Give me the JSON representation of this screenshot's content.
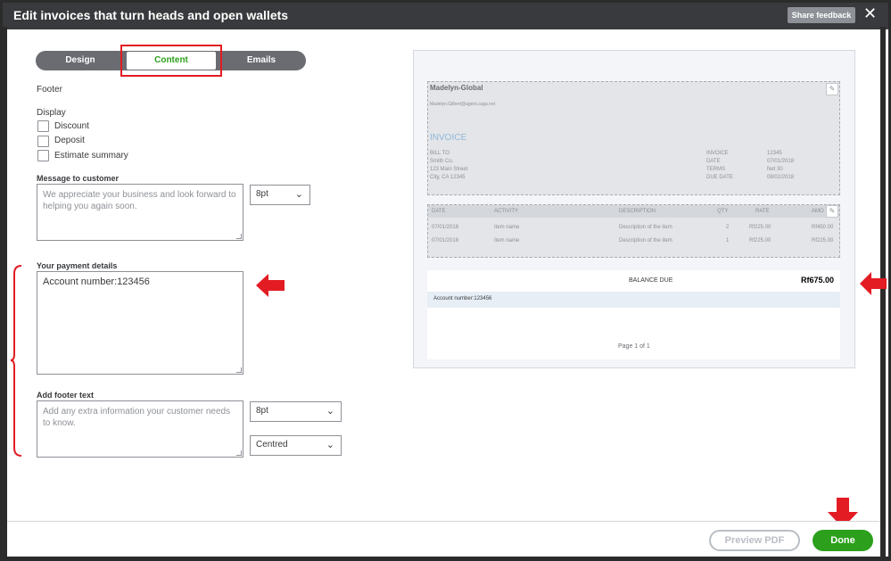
{
  "window": {
    "title": "Edit invoices that turn heads and open wallets",
    "share_feedback": "Share feedback",
    "close": "✕"
  },
  "tabs": [
    {
      "label": "Design"
    },
    {
      "label": "Content"
    },
    {
      "label": "Emails"
    }
  ],
  "form": {
    "section": "Footer",
    "display_label": "Display",
    "checkboxes": [
      {
        "label": "Discount",
        "checked": false
      },
      {
        "label": "Deposit",
        "checked": false
      },
      {
        "label": "Estimate summary",
        "checked": false
      }
    ],
    "message_label": "Message to customer",
    "message_placeholder": "We appreciate your business and look forward to helping you again soon.",
    "message_font_size": "8pt",
    "payment_label": "Your payment details",
    "payment_value": "Account number:123456",
    "footer_label": "Add footer text",
    "footer_placeholder": "Add any extra information your customer needs to know.",
    "footer_font_size": "8pt",
    "footer_align": "Centred"
  },
  "preview": {
    "company": "Madelyn-Global",
    "email": "Madelyn.Gilbert@agent.cuga.net",
    "invoice_title": "INVOICE",
    "bill_to_label": "BILL TO",
    "bill_to_lines": [
      "Smith Co.",
      "123 Main Street",
      "City, CA 12345"
    ],
    "meta_labels": [
      "INVOICE",
      "DATE",
      "TERMS",
      "DUE DATE"
    ],
    "meta_values": [
      "12345",
      "07/01/2018",
      "Net 30",
      "08/02/2018"
    ],
    "columns": [
      "DATE",
      "ACTIVITY",
      "DESCRIPTION",
      "QTY",
      "RATE",
      "AMO"
    ],
    "rows": [
      [
        "07/01/2018",
        "Item name",
        "Description of the item",
        "2",
        "Rf225.00",
        "Rf450.00"
      ],
      [
        "07/01/2018",
        "Item name",
        "Description of the item",
        "1",
        "Rf225.00",
        "Rf225.00"
      ]
    ],
    "balance_label": "BALANCE DUE",
    "balance_value": "Rf675.00",
    "account_line": "Account number:123456",
    "page_label": "Page 1 of 1"
  },
  "footer": {
    "preview_pdf": "Preview PDF",
    "done": "Done"
  },
  "colors": {
    "accent_green": "#2ca01c",
    "annotation_red": "#e31b23",
    "title_bar": "#393a3d"
  }
}
